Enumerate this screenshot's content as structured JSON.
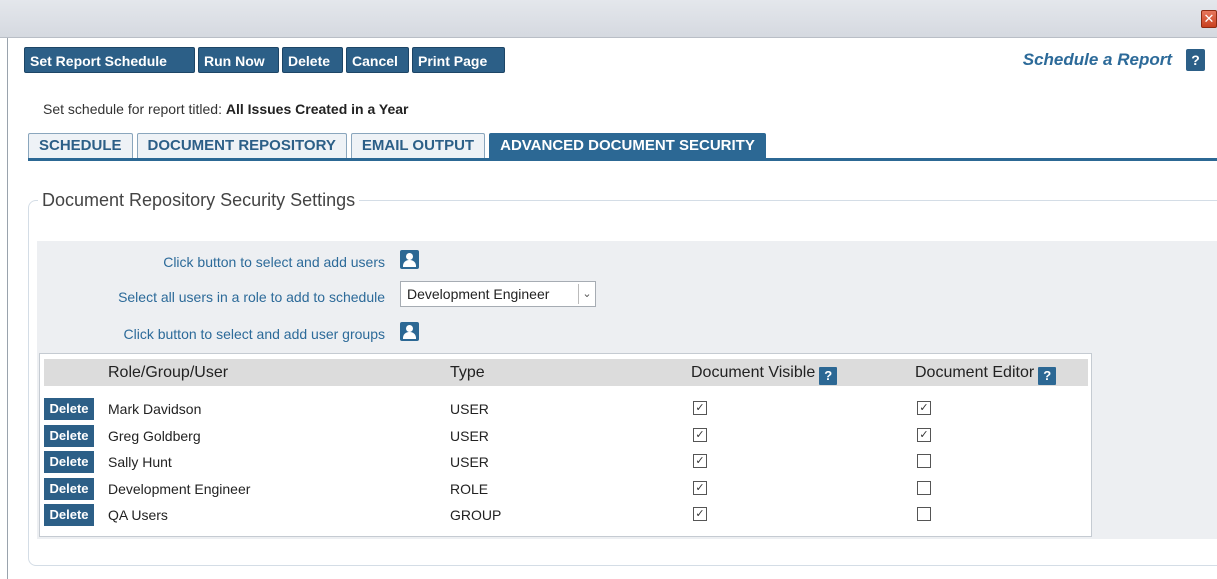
{
  "window": {
    "close_glyph": "✕"
  },
  "toolbar": {
    "buttons": [
      "Set Report Schedule",
      "Run Now",
      "Delete",
      "Cancel",
      "Print Page"
    ]
  },
  "header": {
    "title": "Schedule a Report",
    "help": "?"
  },
  "subtitle": {
    "prefix": "Set schedule for report titled: ",
    "report_title": "All Issues Created in a Year"
  },
  "tabs": [
    "SCHEDULE",
    "DOCUMENT REPOSITORY",
    "EMAIL OUTPUT",
    "ADVANCED DOCUMENT SECURITY"
  ],
  "active_tab": "ADVANCED DOCUMENT SECURITY",
  "section": {
    "legend": "Document Repository Security Settings",
    "add_users_label": "Click button to select and add users",
    "role_label": "Select all users in a role to add to schedule",
    "role_select_value": "Development Engineer",
    "add_groups_label": "Click button to select and add user groups"
  },
  "table": {
    "headers": {
      "name": "Role/Group/User",
      "type": "Type",
      "visible": "Document Visible",
      "editor": "Document Editor",
      "help": "?"
    },
    "delete_label": "Delete",
    "rows": [
      {
        "name": "Mark Davidson",
        "type": "USER",
        "visible": true,
        "editor": true
      },
      {
        "name": "Greg Goldberg",
        "type": "USER",
        "visible": true,
        "editor": true
      },
      {
        "name": "Sally Hunt",
        "type": "USER",
        "visible": true,
        "editor": false
      },
      {
        "name": "Development Engineer",
        "type": "ROLE",
        "visible": true,
        "editor": false
      },
      {
        "name": "QA Users",
        "type": "GROUP",
        "visible": true,
        "editor": false
      }
    ]
  },
  "colors": {
    "accent": "#2c5f87",
    "link": "#2c6a99",
    "panel": "#edeff2"
  }
}
